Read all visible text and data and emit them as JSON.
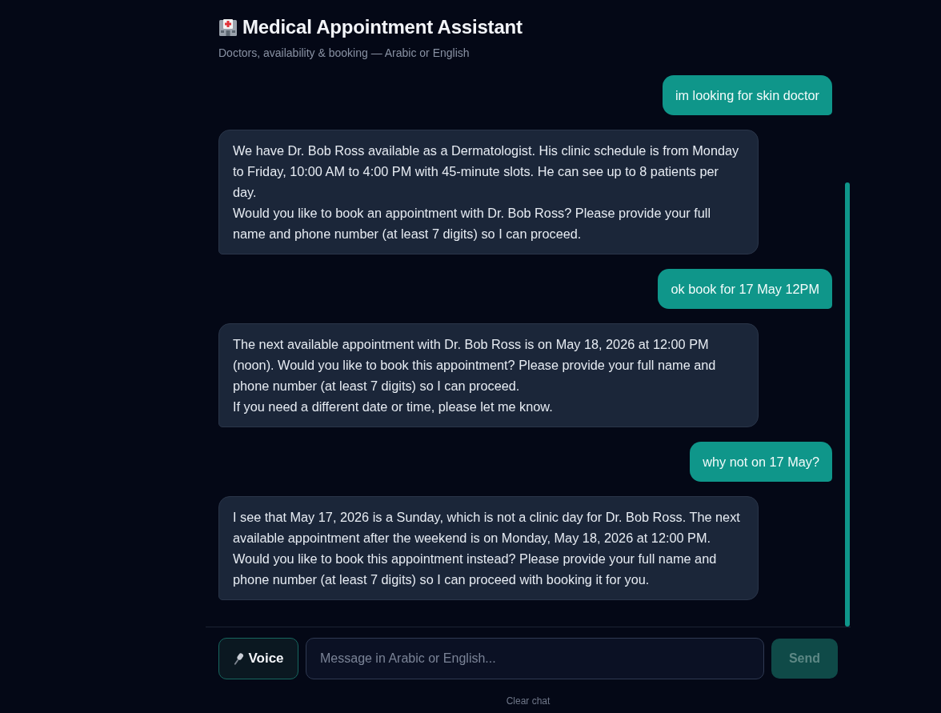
{
  "header": {
    "title": "Medical Appointment Assistant",
    "subtitle": "Doctors, availability & booking — Arabic or English"
  },
  "messages": [
    {
      "kind": "user",
      "text": "im looking for skin doctor"
    },
    {
      "kind": "assistant",
      "text": "We have Dr. Bob Ross available as a Dermatologist. His clinic schedule is from Monday to Friday, 10:00 AM to 4:00 PM with 45-minute slots. He can see up to 8 patients per day.\nWould you like to book an appointment with Dr. Bob Ross? Please provide your full name and phone number (at least 7 digits) so I can proceed."
    },
    {
      "kind": "user",
      "text": "ok book for 17 May 12PM"
    },
    {
      "kind": "assistant",
      "text": "The next available appointment with Dr. Bob Ross is on May 18, 2026 at 12:00 PM (noon). Would you like to book this appointment? Please provide your full name and phone number (at least 7 digits) so I can proceed.\nIf you need a different date or time, please let me know."
    },
    {
      "kind": "user",
      "text": "why not on 17 May?"
    },
    {
      "kind": "assistant",
      "text": "I see that May 17, 2026 is a Sunday, which is not a clinic day for Dr. Bob Ross. The next available appointment after the weekend is on Monday, May 18, 2026 at 12:00 PM.\nWould you like to book this appointment instead? Please provide your full name and phone number (at least 7 digits) so I can proceed with booking it for you."
    }
  ],
  "composer": {
    "voice_button": "Voice",
    "input": {
      "placeholder": "Message in Arabic or English..."
    },
    "send_button": {
      "label": "Send",
      "disabled": true
    }
  },
  "clear_chat": "Clear chat"
}
